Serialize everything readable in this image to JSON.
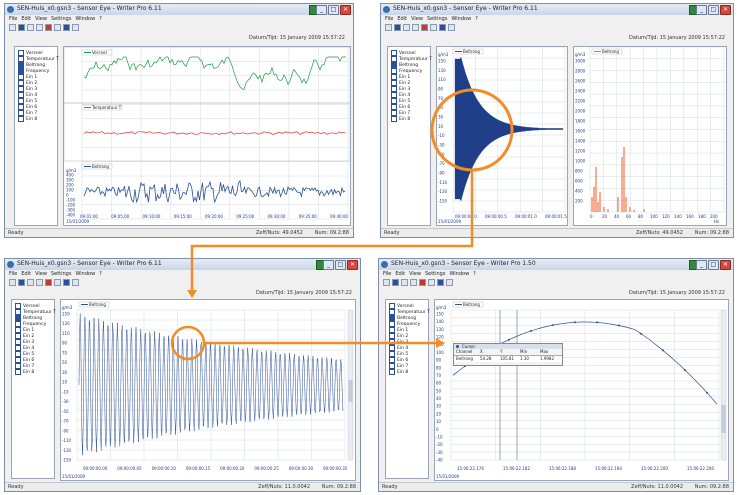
{
  "colors": {
    "orange": "#f28c28",
    "blue": "#2c4f99",
    "green": "#1e9b4a",
    "red": "#e04030",
    "orange_bars": "#f3683a"
  },
  "icons": [
    "app-icon",
    "minimize-icon",
    "maximize-icon",
    "close-icon",
    "new-icon",
    "open-icon",
    "save-icon",
    "print-icon",
    "chart-icon",
    "table-icon",
    "settings-icon",
    "help-icon"
  ],
  "win_buttons": {
    "min": "_",
    "max": "□",
    "close": "✕"
  },
  "windows": [
    {
      "title": "SEN-Huis_x0.gsn3 - Sensor Eye - Writer Pro 6.11",
      "menu": [
        "File",
        "Edit",
        "View",
        "Settings",
        "Window",
        "?"
      ],
      "datetime": "Datum/Tijd: 15 January 2009 15:57:22",
      "channels": [
        {
          "label": "Versnel",
          "on": false
        },
        {
          "label": "Temperatuur T",
          "on": false
        },
        {
          "label": "Beltrong",
          "on": true
        },
        {
          "label": "Frequency",
          "on": true
        },
        {
          "label": "Ein 1",
          "on": false
        },
        {
          "label": "Ein 2",
          "on": false
        },
        {
          "label": "Ein 3",
          "on": false
        },
        {
          "label": "Ein 4",
          "on": false
        },
        {
          "label": "Ein 5",
          "on": false
        },
        {
          "label": "Ein 6",
          "on": false
        },
        {
          "label": "Ein 7",
          "on": false
        },
        {
          "label": "Ein 8",
          "on": false
        }
      ],
      "legends": [
        "Versnel",
        "Temperatuur T",
        "Beltrong"
      ],
      "y_unit": "g/m3",
      "y_ticks_bottom": [
        "400",
        "300",
        "200",
        "100",
        "0",
        "-100",
        "-200",
        "-300",
        "-400"
      ],
      "x_ticks": [
        "09:01:00",
        "09:05:00",
        "09:10:00",
        "09:15:00",
        "09:20:00",
        "09:25:00",
        "09:30:00",
        "09:35:00",
        "09:40:00"
      ],
      "x_date": "15/01/2009",
      "status_left": "Ready",
      "status_mid": "Zeff/Nuts: 49.0452",
      "status_right": "Num: 09.2:88"
    },
    {
      "title": "SEN-Huis_x0.gsn3 - Sensor Eye - Writer Pro 6.11",
      "menu": [
        "File",
        "Edit",
        "View",
        "Settings",
        "Window",
        "?"
      ],
      "datetime": "Datum/Tijd: 15 January 2009 15:57:22",
      "channels": [
        {
          "label": "Versnel",
          "on": false
        },
        {
          "label": "Temperatuur T",
          "on": false
        },
        {
          "label": "Beltrong",
          "on": true
        },
        {
          "label": "Frequency",
          "on": false
        },
        {
          "label": "Ein 1",
          "on": false
        },
        {
          "label": "Ein 2",
          "on": false
        },
        {
          "label": "Ein 3",
          "on": false
        },
        {
          "label": "Ein 4",
          "on": false
        },
        {
          "label": "Ein 5",
          "on": false
        },
        {
          "label": "Ein 6",
          "on": false
        },
        {
          "label": "Ein 7",
          "on": false
        },
        {
          "label": "Ein 8",
          "on": false
        }
      ],
      "legend_left": "Beltrong",
      "legend_right": "Beltrong",
      "y_unit": "g/m3",
      "y_ticks": [
        "150",
        "130",
        "110",
        "90",
        "70",
        "50",
        "30",
        "10",
        "-10",
        "-30",
        "-50",
        "-70",
        "-90",
        "-110",
        "-130",
        "-150"
      ],
      "x_ticks_left": [
        "09:00:00.0",
        "09:00:00.5",
        "09:00:01.0",
        "09:00:01.5"
      ],
      "x_date": "15/01/2009",
      "y_ticks_right": [
        "3000",
        "2800",
        "2600",
        "2400",
        "2200",
        "2000",
        "1800",
        "1600",
        "1400",
        "1200",
        "1000",
        "800",
        "600",
        "400",
        "200"
      ],
      "y_unit_right": "g/m3",
      "x_ticks_right": [
        "0",
        "20",
        "40",
        "60",
        "80",
        "100",
        "120",
        "140",
        "160",
        "180",
        "200"
      ],
      "x_unit_right": "Hz",
      "status_left": "Ready",
      "status_mid": "Zeff/Nuts: 49.0452",
      "status_right": "Num: 09.2:88"
    },
    {
      "title": "SEN-Huis_x0.gsn3 - Sensor Eye - Writer Pro 6.11",
      "menu": [
        "File",
        "Edit",
        "View",
        "Settings",
        "Window",
        "?"
      ],
      "datetime": "Datum/Tijd: 15 January 2009 15:57:22",
      "channels": [
        {
          "label": "Versnel",
          "on": false
        },
        {
          "label": "Temperatuur T",
          "on": false
        },
        {
          "label": "Beltrong",
          "on": true
        },
        {
          "label": "Frequency",
          "on": false
        },
        {
          "label": "Ein 1",
          "on": false
        },
        {
          "label": "Ein 2",
          "on": false
        },
        {
          "label": "Ein 3",
          "on": false
        },
        {
          "label": "Ein 4",
          "on": false
        },
        {
          "label": "Ein 5",
          "on": false
        },
        {
          "label": "Ein 6",
          "on": false
        },
        {
          "label": "Ein 7",
          "on": false
        },
        {
          "label": "Ein 8",
          "on": false
        }
      ],
      "legend": "Beltrong",
      "y_unit": "g/m3",
      "y_ticks": [
        "150",
        "130",
        "110",
        "90",
        "70",
        "50",
        "30",
        "10",
        "-10",
        "-30",
        "-50",
        "-70",
        "-90",
        "-110",
        "-130",
        "-150"
      ],
      "x_ticks": [
        "09:00:00.00",
        "09:00:00.05",
        "09:00:00.10",
        "09:00:00.15",
        "09:00:00.20",
        "09:00:00.25",
        "09:00:00.30",
        "09:00:00.35"
      ],
      "x_date": "15/01/2009",
      "status_left": "Ready",
      "status_mid": "Zeff/Nuts: 11.0.0042",
      "status_right": "Num: 09.2:88"
    },
    {
      "title": "SEN-Huis_x0.gsn3 - Sensor Eye - Writer Pro 1.50",
      "menu": [
        "File",
        "Edit",
        "View",
        "Settings",
        "Window",
        "?"
      ],
      "datetime": "Datum/Tijd: 15 January 2009 15:57:22",
      "channels": [
        {
          "label": "Versnel",
          "on": false
        },
        {
          "label": "Temperatuur T",
          "on": false
        },
        {
          "label": "Beltrong",
          "on": true
        },
        {
          "label": "Frequency",
          "on": false
        },
        {
          "label": "Ein 1",
          "on": false
        },
        {
          "label": "Ein 2",
          "on": false
        },
        {
          "label": "Ein 3",
          "on": false
        },
        {
          "label": "Ein 4",
          "on": false
        },
        {
          "label": "Ein 5",
          "on": false
        },
        {
          "label": "Ein 6",
          "on": false
        },
        {
          "label": "Ein 7",
          "on": false
        },
        {
          "label": "Ein 8",
          "on": false
        }
      ],
      "legend": "Beltrong",
      "y_unit": "g/m3",
      "y_ticks": [
        "150",
        "140",
        "130",
        "120",
        "110",
        "100",
        "90",
        "80",
        "70",
        "60",
        "50",
        "40",
        "30",
        "20",
        "10",
        "0",
        "-10",
        "-20",
        "-30",
        "-40"
      ],
      "x_ticks": [
        "15:06:22.176",
        "15:06:22.182",
        "15:06:22.188",
        "15:06:22.194",
        "15:06:22.200",
        "15:06:22.206"
      ],
      "x_date": "15/01/2009",
      "popup_title": "Cursor",
      "popup_cols": [
        "Channel",
        "X",
        "Y",
        "Min",
        "Max"
      ],
      "popup_row": [
        "Beltrong",
        "54.28",
        "105.81",
        "1.10",
        "1.9982"
      ],
      "status_left": "Ready",
      "status_mid": "Zeff/Nuts: 11.0.0042",
      "status_right": "Num: 09.2:88"
    }
  ]
}
